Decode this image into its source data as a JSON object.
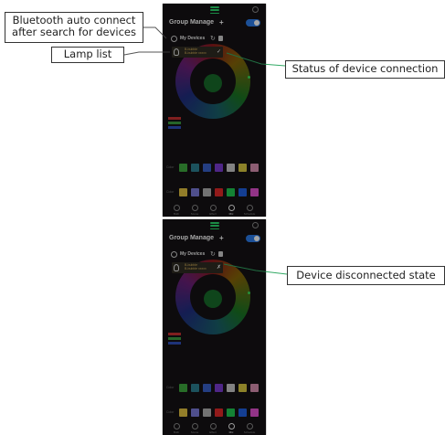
{
  "callouts": {
    "bluetooth": "Bluetooth auto connect\nafter search for devices",
    "lamp_list": "Lamp list",
    "status": "Status of device connection",
    "disconnected": "Device disconnected state"
  },
  "screen": {
    "title": "Group Manage",
    "add": "+",
    "devices_label": "My Devices",
    "lamp_name": "B-bubble\nB-bubble xxxxx",
    "connected_symbol": "✓",
    "disconnected_symbol": "✗",
    "tabs": [
      "Bulb",
      "Scene",
      "Effect",
      "Mic",
      "Schedule"
    ]
  },
  "colors": {
    "accent_green": "#2ad66b",
    "toggle_blue": "#2b7be8",
    "screen_bg": "#141214"
  },
  "swatches": {
    "row1": [
      "#3ea83e",
      "#2b7f8f",
      "#3860c8",
      "#7a3bd0",
      "#c8c8c8",
      "#d8c840",
      "#d88fb0"
    ],
    "row2": [
      "#e0c040",
      "#7a7ad8",
      "#b0b0b0",
      "#e02828",
      "#20c850",
      "#2060e0",
      "#e050d0"
    ]
  }
}
